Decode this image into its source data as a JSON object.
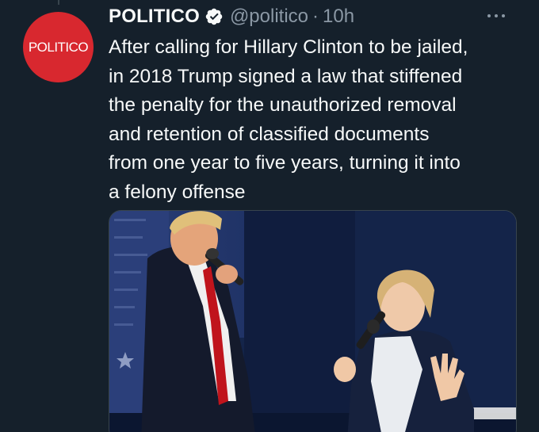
{
  "author": {
    "display_name": "POLITICO",
    "handle": "@politico",
    "separator": "·",
    "timestamp": "10h",
    "avatar_text": "POLITICO",
    "verified": true
  },
  "tweet": {
    "text": "After calling for Hillary Clinton to be jailed,\nin 2018 Trump signed a law that stiffened\nthe penalty for the unauthorized removal\nand retention of classified documents\nfrom one year to five years, turning it into\na felony offense"
  },
  "icons": {
    "verified": "verified-badge-icon",
    "more": "more-options-icon"
  },
  "colors": {
    "background": "#15202b",
    "avatar_red": "#d8282f",
    "secondary_text": "#8b98a5",
    "border": "#38444d"
  }
}
